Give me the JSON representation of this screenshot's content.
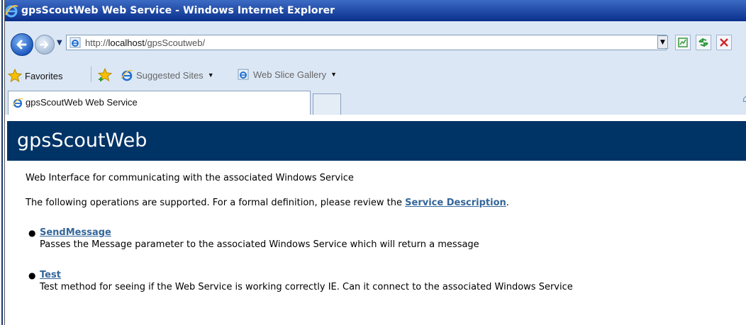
{
  "window": {
    "title": "gpsScoutWeb Web Service - Windows Internet Explorer"
  },
  "address_bar": {
    "url_prefix": "http://",
    "url_host": "localhost",
    "url_path": "/gpsScoutweb/"
  },
  "favorites_bar": {
    "favorites_label": "Favorites",
    "suggested_sites_label": "Suggested Sites",
    "web_slice_label": "Web Slice Gallery"
  },
  "tabs": [
    {
      "label": "gpsScoutWeb Web Service"
    }
  ],
  "page": {
    "heading": "gpsScoutWeb",
    "intro": "Web Interface for communicating with the associated Windows Service",
    "ops_text_before": "The following operations are supported. For a formal definition, please review the ",
    "ops_link": "Service Description",
    "ops_text_after": ".",
    "operations": [
      {
        "name": "SendMessage",
        "description": "Passes the Message parameter to the associated Windows Service which will return a message"
      },
      {
        "name": "Test",
        "description": "Test method for seeing if the Web Service is working correctly IE. Can it connect to the associated Windows Service"
      }
    ]
  },
  "colors": {
    "banner": "#003366",
    "link": "#336699",
    "titlebar": "#0a2f8c"
  }
}
